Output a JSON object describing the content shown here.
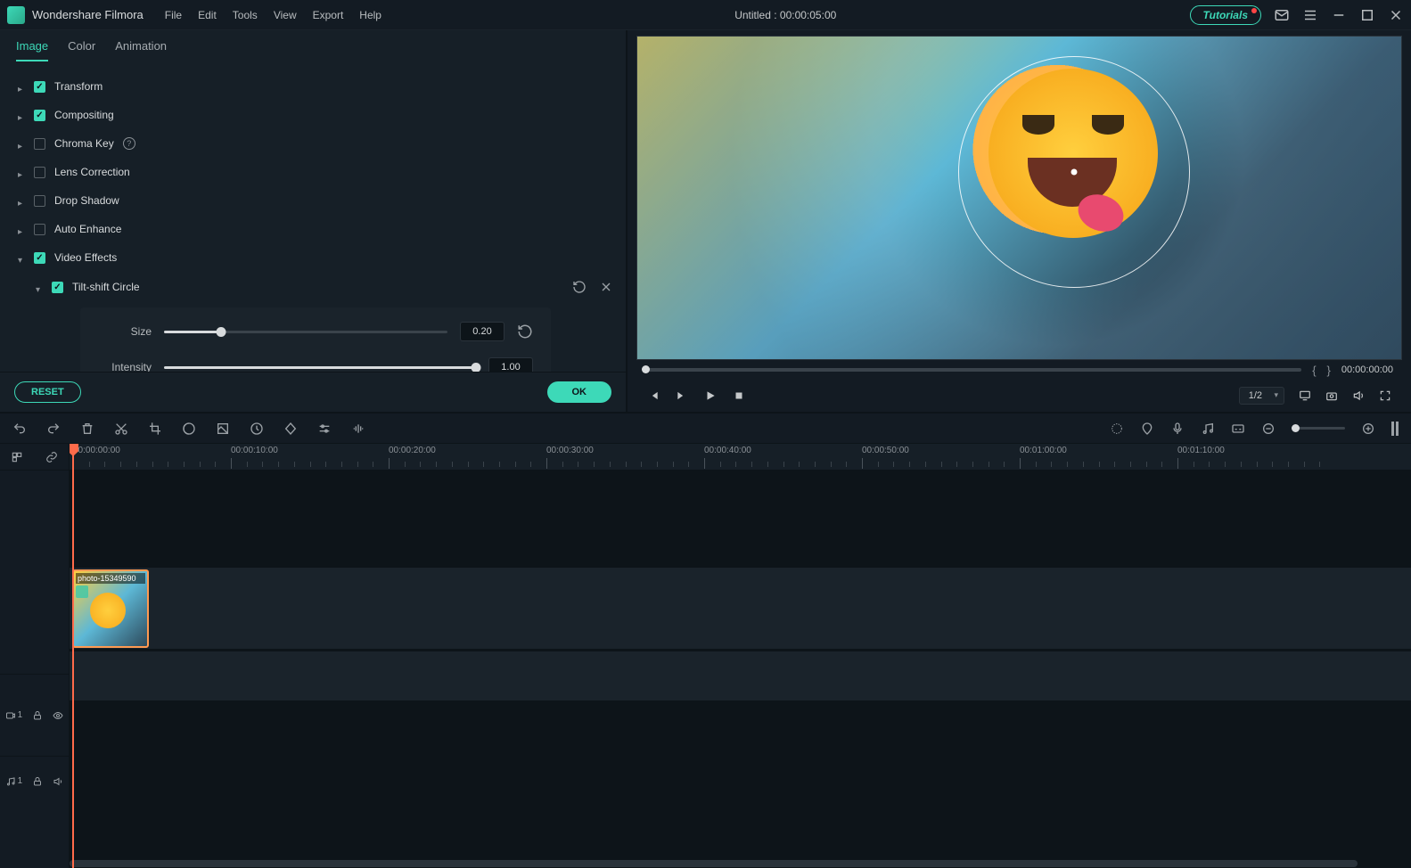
{
  "app": {
    "title": "Wondershare Filmora",
    "document_title": "Untitled : 00:00:05:00",
    "tutorials_label": "Tutorials"
  },
  "menu": [
    "File",
    "Edit",
    "Tools",
    "View",
    "Export",
    "Help"
  ],
  "tabs": {
    "active": "Image",
    "items": [
      "Image",
      "Color",
      "Animation"
    ]
  },
  "props": {
    "transform": "Transform",
    "compositing": "Compositing",
    "chroma": "Chroma Key",
    "lens": "Lens Correction",
    "drop": "Drop Shadow",
    "auto": "Auto Enhance",
    "vfx": "Video Effects",
    "tilt": "Tilt-shift Circle"
  },
  "sliders": {
    "size_label": "Size",
    "size_value": "0.20",
    "intensity_label": "Intensity",
    "intensity_value": "1.00"
  },
  "buttons": {
    "reset": "RESET",
    "ok": "OK"
  },
  "preview": {
    "timecode": "00:00:00:00",
    "ratio": "1/2"
  },
  "ruler": [
    "00:00:00:00",
    "00:00:10:00",
    "00:00:20:00",
    "00:00:30:00",
    "00:00:40:00",
    "00:00:50:00",
    "00:01:00:00",
    "00:01:10:00"
  ],
  "clip": {
    "name": "photo-15349590"
  },
  "track_labels": {
    "video": "1",
    "audio": "1"
  }
}
